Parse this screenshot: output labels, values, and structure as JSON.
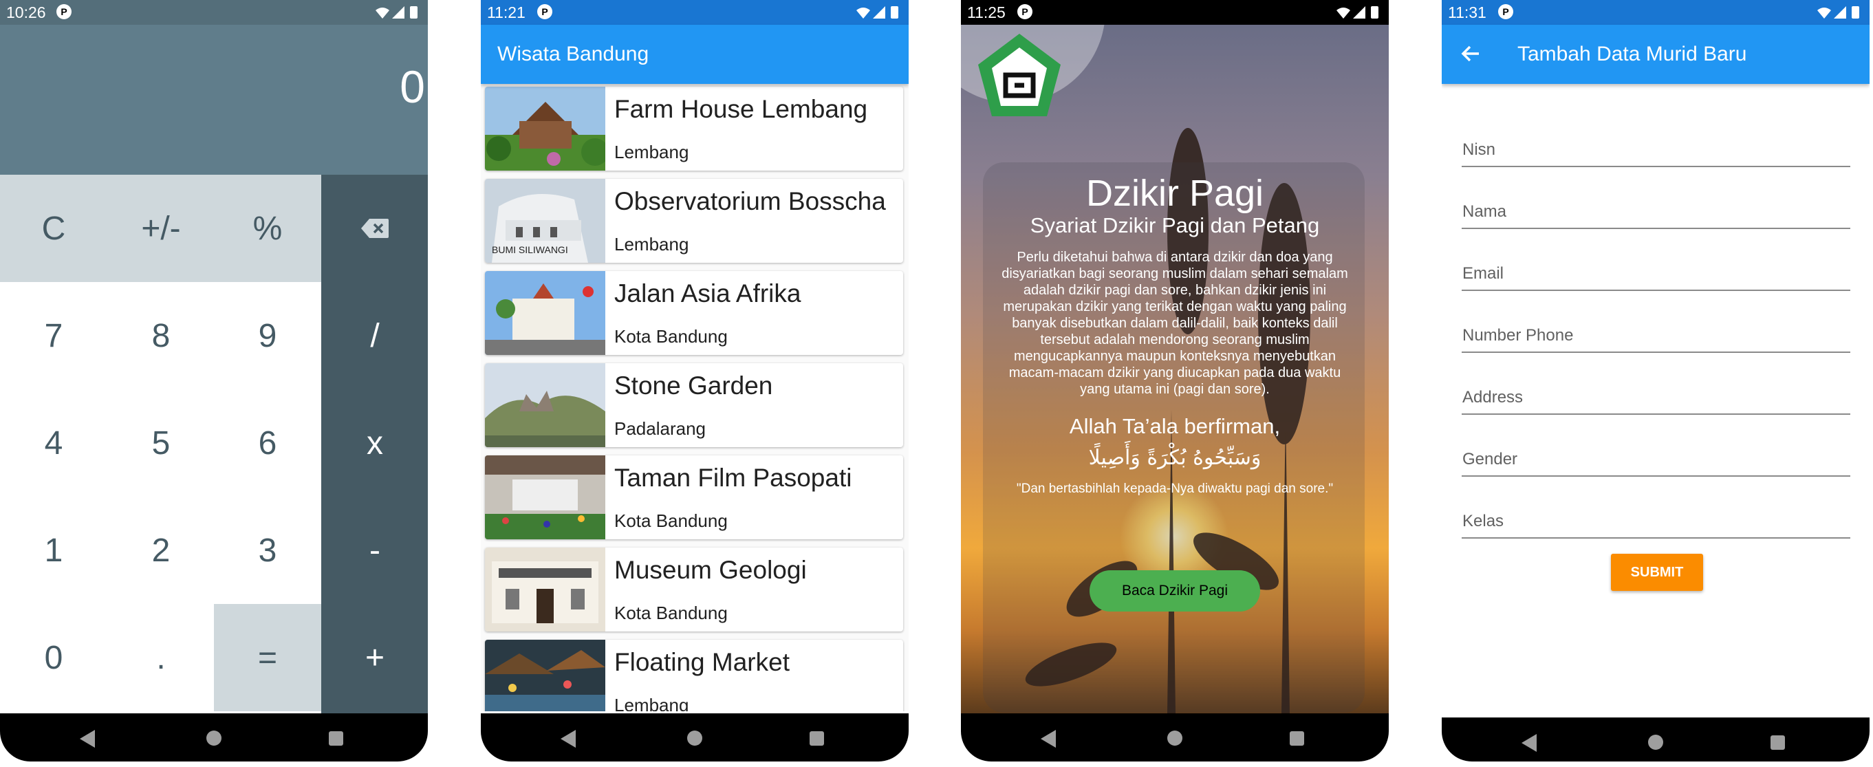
{
  "calculator": {
    "status_time": "10:26",
    "display": "0",
    "keys": {
      "clear": "C",
      "sign": "+/-",
      "percent": "%",
      "seven": "7",
      "eight": "8",
      "nine": "9",
      "divide": "/",
      "four": "4",
      "five": "5",
      "six": "6",
      "multiply": "x",
      "one": "1",
      "two": "2",
      "three": "3",
      "minus": "-",
      "zero": "0",
      "dot": ".",
      "equals": "=",
      "plus": "+"
    },
    "backspace_icon": "backspace-icon"
  },
  "wisata": {
    "status_time": "11:21",
    "title": "Wisata Bandung",
    "items": [
      {
        "name": "Farm House Lembang",
        "location": "Lembang"
      },
      {
        "name": "Observatorium Bosscha",
        "location": "Lembang"
      },
      {
        "name": "Jalan Asia Afrika",
        "location": "Kota Bandung"
      },
      {
        "name": "Stone Garden",
        "location": "Padalarang"
      },
      {
        "name": "Taman Film Pasopati",
        "location": "Kota Bandung"
      },
      {
        "name": "Museum Geologi",
        "location": "Kota Bandung"
      },
      {
        "name": "Floating Market",
        "location": "Lembang"
      }
    ]
  },
  "dzikir": {
    "status_time": "11:25",
    "title": "Dzikir Pagi",
    "subtitle": "Syariat Dzikir Pagi dan Petang",
    "body": "Perlu diketahui bahwa di antara dzikir dan doa yang disyariatkan bagi seorang muslim dalam sehari semalam adalah dzikir pagi dan sore, bahkan dzikir jenis ini merupakan dzikir yang terikat dengan waktu yang paling banyak disebutkan dalam dalil-dalil, baik konteks dalil tersebut adalah mendorong seorang muslim mengucapkannya maupun konteksnya menyebutkan macam-macam dzikir yang diucapkan pada dua waktu yang utama ini (pagi dan sore).",
    "firman": "Allah Ta’ala berfirman,",
    "arabic": "وَسَبِّحُوهُ بُكْرَةً وَأَصِيلًا",
    "quote": "\"Dan bertasbihlah kepada-Nya diwaktu pagi dan sore.\"",
    "button": "Baca Dzikir Pagi"
  },
  "form": {
    "status_time": "11:31",
    "title": "Tambah Data Murid Baru",
    "fields": [
      "Nisn",
      "Nama",
      "Email",
      "Number Phone",
      "Address",
      "Gender",
      "Kelas"
    ],
    "submit": "SUBMIT"
  },
  "colors": {
    "calc_dark": "#455a64",
    "calc_light": "#cfd8dc",
    "appbar_blue": "#2196f3",
    "dzikir_button": "#4caf50",
    "submit_orange": "#fb8c00"
  }
}
